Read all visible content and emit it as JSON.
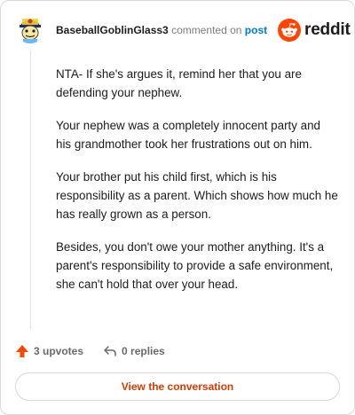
{
  "comment": {
    "username": "BaseballGoblinGlass3",
    "action_text": "commented on",
    "post_link": "post",
    "paragraphs": [
      "NTA- If she's argues it, remind her that you are defending your nephew.",
      "Your nephew was a completely innocent party and his grandmother took her frustrations out on him.",
      "Your brother put his child first, which is his responsibility as a parent. Which shows how much he has really grown as a person.",
      "Besides, you don't owe your mother anything. It's a parent's responsibility to provide a safe environment, she can't hold that over your head."
    ]
  },
  "brand": {
    "wordmark": "reddit",
    "color": "#ff4500"
  },
  "stats": {
    "upvotes": "3 upvotes",
    "replies": "0 replies"
  },
  "cta": {
    "label": "View the conversation",
    "color": "#d93a00"
  },
  "icons": {
    "avatar": "baseball-goblin-avatar",
    "upvote": "upvote-arrow-icon",
    "reply": "reply-arrow-icon",
    "logo": "reddit-snoo-icon"
  }
}
